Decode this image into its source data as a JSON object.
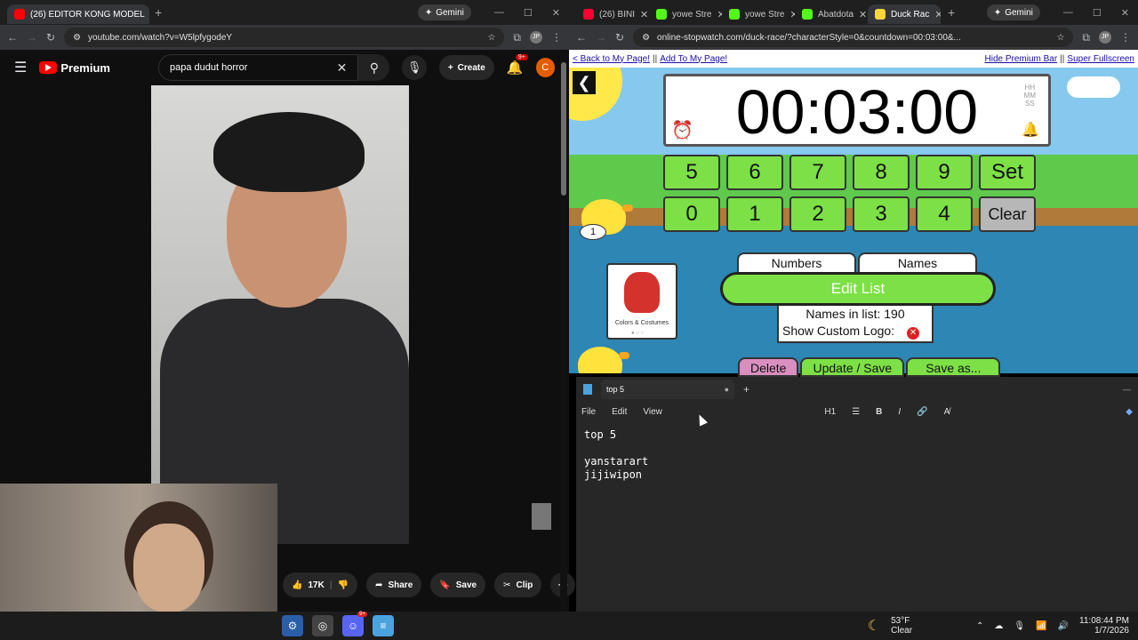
{
  "left_browser": {
    "tab_title": "(26) EDITOR KONG MODEL",
    "gemini_label": "Gemini",
    "url": "youtube.com/watch?v=W5lpfygodeY"
  },
  "youtube": {
    "premium_label": "Premium",
    "search_value": "papa dudut horror",
    "create_label": "Create",
    "notification_badge": "9+",
    "avatar_letter": "C",
    "like_count": "17K",
    "share_label": "Share",
    "save_label": "Save",
    "clip_label": "Clip"
  },
  "right_browser": {
    "tabs": [
      {
        "title": "(26) BINI",
        "color": "#ff0033"
      },
      {
        "title": "yowe Stre",
        "color": "#53fc18"
      },
      {
        "title": "yowe Stre",
        "color": "#53fc18"
      },
      {
        "title": "Abatdota",
        "color": "#53fc18"
      },
      {
        "title": "Duck Rac",
        "color": "#ffd53a"
      }
    ],
    "gemini_label": "Gemini",
    "url": "online-stopwatch.com/duck-race/?characterStyle=0&countdown=00:03:00&..."
  },
  "site": {
    "back_link": "< Back to My Page!",
    "add_link": "Add To My Page!",
    "hide_bar": "Hide Premium Bar",
    "fullscreen": "Super Fullscreen",
    "timer": "00:03:00",
    "hms": [
      "HH",
      "MM",
      "SS"
    ],
    "keys_row1": [
      "5",
      "6",
      "7",
      "8",
      "9",
      "Set"
    ],
    "keys_row2": [
      "0",
      "1",
      "2",
      "3",
      "4",
      "Clear"
    ],
    "duck_number": "1",
    "card_label": "Colors & Costumes",
    "tab_numbers": "Numbers",
    "tab_names": "Names",
    "edit_list": "Edit List",
    "names_in_list": "Names in list: 190",
    "show_logo": "Show Custom Logo:",
    "delete_label": "Delete",
    "update_label": "Update / Save",
    "save_as_label": "Save as..."
  },
  "notepad": {
    "tab_title": "top 5",
    "menu": [
      "File",
      "Edit",
      "View"
    ],
    "heading_select": "H1",
    "content": "top 5\n\nyanstarart\njijiwipon"
  },
  "taskbar": {
    "temperature": "53°F",
    "weather": "Clear",
    "time": "11:08:44 PM",
    "date": "1/7/2026",
    "discord_badge": "9+"
  },
  "colors": {
    "youtube_red": "#ff0000",
    "key_green": "#7de046",
    "notepad_bg": "#272727"
  }
}
